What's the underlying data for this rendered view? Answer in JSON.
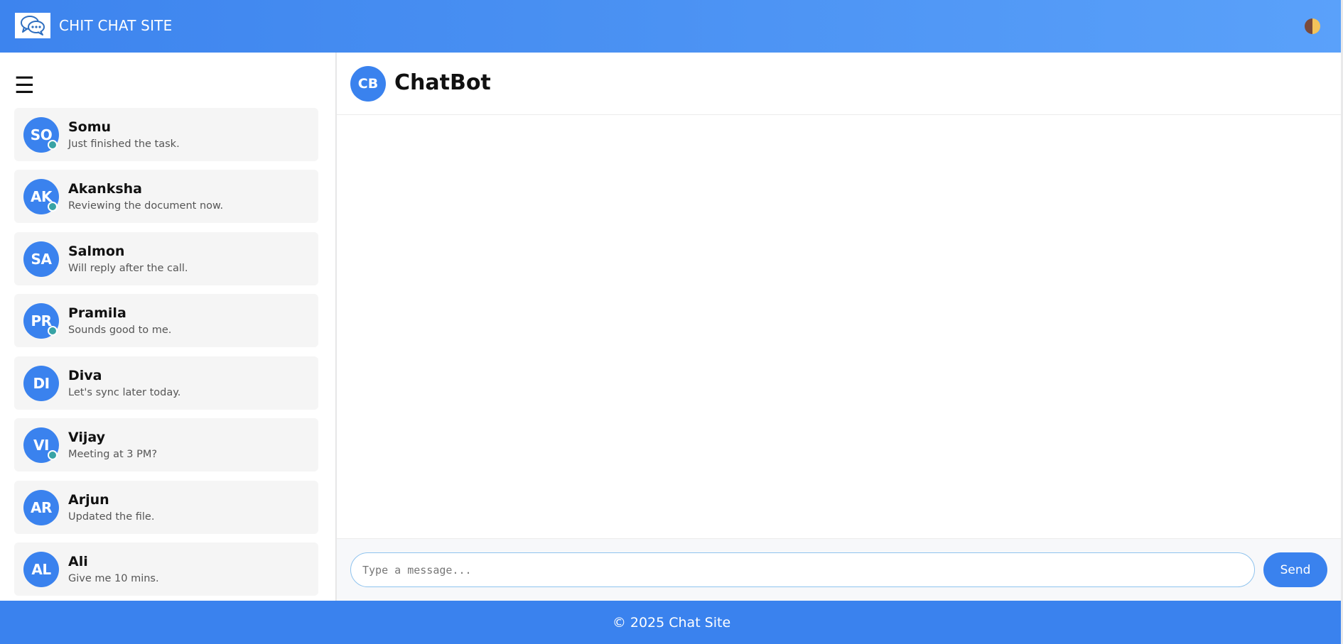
{
  "header": {
    "site_title": "CHIT CHAT SITE",
    "logo_icon": "chat-bubbles-icon",
    "theme_toggle_icon": "theme-toggle-icon"
  },
  "sidebar": {
    "menu_icon": "☰",
    "contacts": [
      {
        "initials": "SO",
        "name": "Somu",
        "last_message": "Just finished the task.",
        "online": true
      },
      {
        "initials": "AK",
        "name": "Akanksha",
        "last_message": "Reviewing the document now.",
        "online": true
      },
      {
        "initials": "SA",
        "name": "Salmon",
        "last_message": "Will reply after the call.",
        "online": false
      },
      {
        "initials": "PR",
        "name": "Pramila",
        "last_message": "Sounds good to me.",
        "online": true
      },
      {
        "initials": "DI",
        "name": "Diva",
        "last_message": "Let's sync later today.",
        "online": false
      },
      {
        "initials": "VI",
        "name": "Vijay",
        "last_message": "Meeting at 3 PM?",
        "online": true
      },
      {
        "initials": "AR",
        "name": "Arjun",
        "last_message": "Updated the file.",
        "online": false
      },
      {
        "initials": "AL",
        "name": "Ali",
        "last_message": "Give me 10 mins.",
        "online": false
      }
    ]
  },
  "chat": {
    "bot_initials": "CB",
    "bot_name": "ChatBot",
    "input_placeholder": "Type a message...",
    "input_value": "",
    "send_label": "Send"
  },
  "footer": {
    "text": "© 2025 Chat Site"
  },
  "colors": {
    "accent": "#3a82ee",
    "online": "#38a3a5",
    "header_gradient_start": "#3d84ee",
    "header_gradient_end": "#5aa1fa"
  }
}
